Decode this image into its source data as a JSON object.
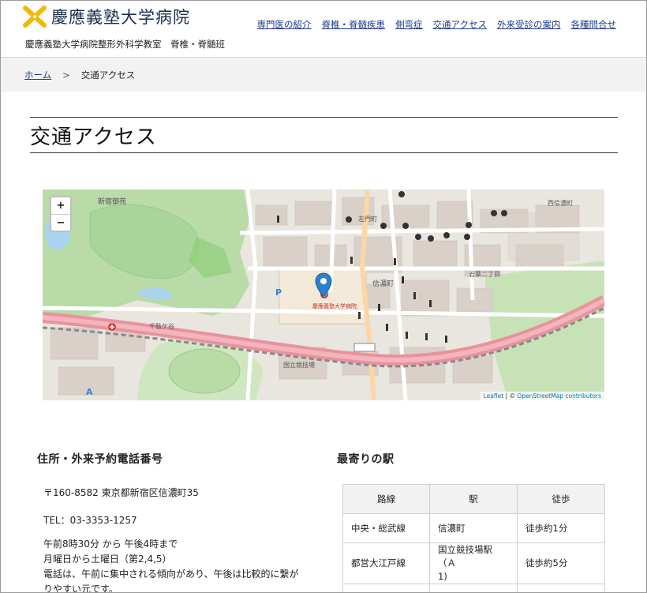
{
  "site": {
    "name": "慶應義塾大学病院",
    "subtitle": "慶應義塾大学病院整形外科学教室　脊椎・脊髄班"
  },
  "nav": [
    {
      "label": "専門医の紹介"
    },
    {
      "label": "脊椎・脊髄疾患"
    },
    {
      "label": "側弯症"
    },
    {
      "label": "交通アクセス"
    },
    {
      "label": "外来受診の案内"
    },
    {
      "label": "各種問合せ"
    }
  ],
  "breadcrumb": {
    "home": "ホーム",
    "separator": ">",
    "current": "交通アクセス"
  },
  "page_title": "交通アクセス",
  "map": {
    "zoom_in": "+",
    "zoom_out": "−",
    "attribution_leaflet": "Leaflet",
    "attribution_sep": " | © ",
    "attribution_osm": "OpenStreetMap contributors",
    "colors": {
      "park": "#b9dba8",
      "highway": "#e8929e",
      "building": "#d9d0c9",
      "marker": "#2a81cb"
    },
    "labels": [
      {
        "text": "新宿御苑"
      },
      {
        "text": "慶應義塾大学病院"
      },
      {
        "text": "信濃町"
      },
      {
        "text": "国立競技場"
      },
      {
        "text": "千駄ケ谷"
      },
      {
        "text": "若葉二丁目"
      },
      {
        "text": "左門町"
      },
      {
        "text": "西信濃町"
      }
    ]
  },
  "address": {
    "heading": "住所・外来予約電話番号",
    "postal": "〒160-8582 東京都新宿区信濃町35",
    "tel": "TEL：03-3353-1257",
    "hours": "午前8時30分 から 午後4時まで",
    "days": "月曜日から土曜日（第2,4,5）",
    "note_line1": "電話は、午前に集中される傾向があり、午後は比較的に繋が",
    "note_line2": "りやすい元です。"
  },
  "stations": {
    "heading": "最寄りの駅",
    "columns": [
      "路線",
      "駅",
      "徒歩"
    ],
    "rows": [
      {
        "line": "中央・総武線",
        "station": "信濃町",
        "walk": "徒歩約1分"
      },
      {
        "line": "都営大江戸線",
        "station_line1": "国立競技場駅（Ａ",
        "station_line2": "1)",
        "walk": "徒歩約5分"
      }
    ]
  }
}
